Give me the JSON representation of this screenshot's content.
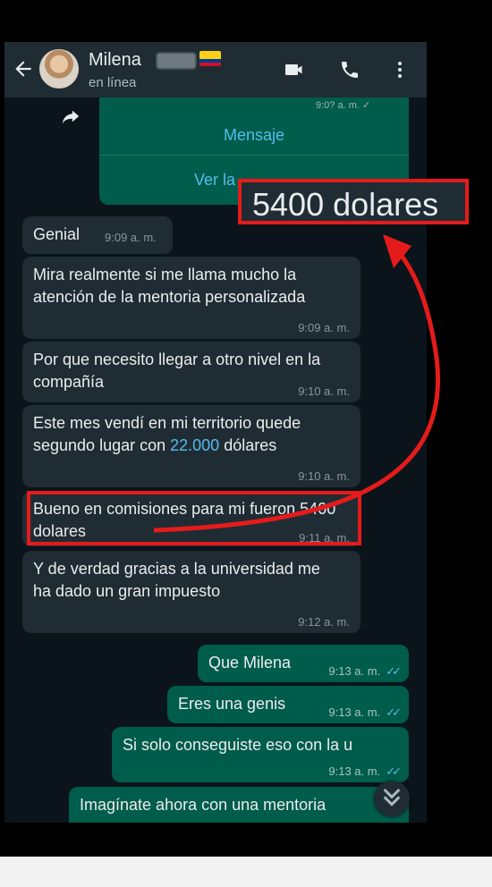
{
  "header": {
    "contact_name": "Milena",
    "status": "en línea",
    "icons": [
      "back-arrow-icon",
      "video-call-icon",
      "phone-call-icon",
      "more-options-icon"
    ]
  },
  "card": {
    "time_partial": "9:0? a. m. ✓",
    "button1": "Mensaje",
    "button2": "Ver la"
  },
  "highlight": {
    "label": "5400 dolares"
  },
  "messages": [
    {
      "text": "Genial",
      "time": "9:09 a. m."
    },
    {
      "text": "Mira realmente si me llama mucho la atención de la mentoria personalizada",
      "time": "9:09 a. m."
    },
    {
      "text": "Por que necesito llegar a otro nivel en la compañía",
      "time": "9:10 a. m."
    },
    {
      "text_before": "Este mes vendí en mi territorio quede segundo lugar con ",
      "link": "22.000",
      "text_after": " dólares",
      "time": "9:10 a. m."
    },
    {
      "text": "Bueno en comisiones para mi fueron 5400 dolares",
      "time": "9:11 a. m."
    },
    {
      "text": "Y de verdad gracias a la universidad me ha dado un gran impuesto",
      "time": "9:12 a. m."
    },
    {
      "text": "Que Milena",
      "time": "9:13 a. m."
    },
    {
      "text": "Eres una genis",
      "time": "9:13 a. m."
    },
    {
      "text": "Si solo conseguiste eso con la u",
      "time": "9:13 a. m."
    },
    {
      "text": "Imagínate ahora con una mentoria"
    }
  ],
  "colors": {
    "chat_bg": "#0b141a",
    "incoming": "#202c33",
    "outgoing": "#005c4b",
    "accent": "#53bdeb",
    "annotation": "#e51b1b"
  }
}
